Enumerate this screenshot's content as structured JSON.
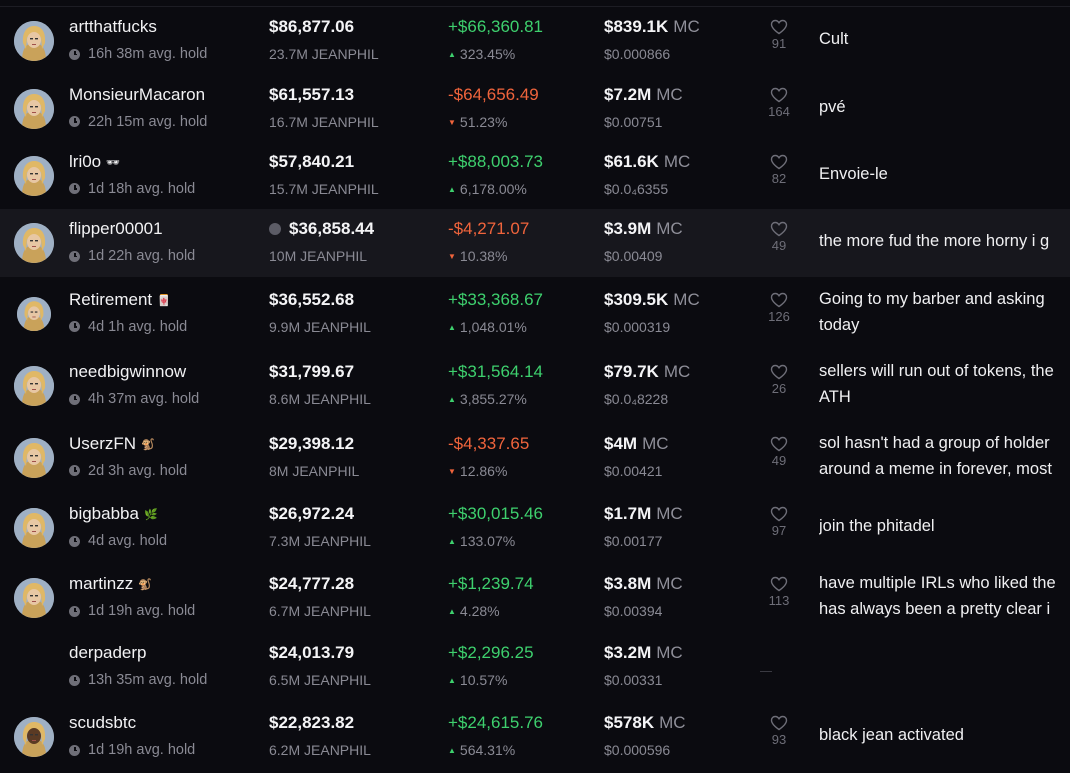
{
  "rows": [
    {
      "username": "artthatfucks",
      "badge": "",
      "hold": "16h 38m avg. hold",
      "usd": "$86,877.06",
      "tokens": "23.7M JEANPHIL",
      "pnl": "+$66,360.81",
      "pnl_dir": "up",
      "pct": "323.45%",
      "mc": "$839.1K",
      "mc_label": "MC",
      "price": "$0.000866",
      "likes": "91",
      "comment": "Cult"
    },
    {
      "username": "MonsieurMacaron",
      "badge": "",
      "hold": "22h 15m avg. hold",
      "usd": "$61,557.13",
      "tokens": "16.7M JEANPHIL",
      "pnl": "-$64,656.49",
      "pnl_dir": "down",
      "pct": "51.23%",
      "mc": "$7.2M",
      "mc_label": "MC",
      "price": "$0.00751",
      "likes": "164",
      "comment": "pvé"
    },
    {
      "username": "lri0o",
      "badge": "🕶",
      "hold": "1d 18h avg. hold",
      "usd": "$57,840.21",
      "tokens": "15.7M JEANPHIL",
      "pnl": "+$88,003.73",
      "pnl_dir": "up",
      "pct": "6,178.00%",
      "mc": "$61.6K",
      "mc_label": "MC",
      "price": "$0.0₄6355",
      "likes": "82",
      "comment": "Envoie-le"
    },
    {
      "username": "flipper00001",
      "badge": "",
      "hold": "1d 22h avg. hold",
      "usd": "$36,858.44",
      "usd_icon": "info-icon",
      "tokens": "10M JEANPHIL",
      "pnl": "-$4,271.07",
      "pnl_dir": "down",
      "pct": "10.38%",
      "mc": "$3.9M",
      "mc_label": "MC",
      "price": "$0.00409",
      "likes": "49",
      "comment": "the more fud the more horny i g"
    },
    {
      "username": "Retirement",
      "badge": "🀄",
      "hold": "4d 1h avg. hold",
      "usd": "$36,552.68",
      "tokens": "9.9M JEANPHIL",
      "pnl": "+$33,368.67",
      "pnl_dir": "up",
      "pct": "1,048.01%",
      "mc": "$309.5K",
      "mc_label": "MC",
      "price": "$0.000319",
      "likes": "126",
      "comment": "Going to my barber and asking \ntoday"
    },
    {
      "username": "needbigwinnow",
      "badge": "",
      "hold": "4h 37m avg. hold",
      "usd": "$31,799.67",
      "tokens": "8.6M JEANPHIL",
      "pnl": "+$31,564.14",
      "pnl_dir": "up",
      "pct": "3,855.27%",
      "mc": "$79.7K",
      "mc_label": "MC",
      "price": "$0.0₄8228",
      "likes": "26",
      "comment": "sellers will run out of tokens, the\nATH"
    },
    {
      "username": "UserzFN",
      "badge": "🐒",
      "hold": "2d 3h avg. hold",
      "usd": "$29,398.12",
      "tokens": "8M JEANPHIL",
      "pnl": "-$4,337.65",
      "pnl_dir": "down",
      "pct": "12.86%",
      "mc": "$4M",
      "mc_label": "MC",
      "price": "$0.00421",
      "likes": "49",
      "comment": "sol hasn't had a group of holder\naround a meme in forever, most"
    },
    {
      "username": "bigbabba",
      "badge": "🌿",
      "hold": "4d avg. hold",
      "usd": "$26,972.24",
      "tokens": "7.3M JEANPHIL",
      "pnl": "+$30,015.46",
      "pnl_dir": "up",
      "pct": "133.07%",
      "mc": "$1.7M",
      "mc_label": "MC",
      "price": "$0.00177",
      "likes": "97",
      "comment": "join the phitadel"
    },
    {
      "username": "martinzz",
      "badge": "🐒",
      "hold": "1d 19h avg. hold",
      "usd": "$24,777.28",
      "tokens": "6.7M JEANPHIL",
      "pnl": "+$1,239.74",
      "pnl_dir": "up",
      "pct": "4.28%",
      "mc": "$3.8M",
      "mc_label": "MC",
      "price": "$0.00394",
      "likes": "113",
      "comment": "have multiple IRLs who liked the\nhas always been a pretty clear i"
    },
    {
      "username": "derpaderp",
      "badge": "",
      "hold": "13h 35m avg. hold",
      "usd": "$24,013.79",
      "tokens": "6.5M JEANPHIL",
      "pnl": "+$2,296.25",
      "pnl_dir": "up",
      "pct": "10.57%",
      "mc": "$3.2M",
      "mc_label": "MC",
      "price": "$0.00331",
      "likes": "",
      "comment": ""
    },
    {
      "username": "scudsbtc",
      "badge": "",
      "hold": "1d 19h avg. hold",
      "usd": "$22,823.82",
      "tokens": "6.2M JEANPHIL",
      "pnl": "+$24,615.76",
      "pnl_dir": "up",
      "pct": "564.31%",
      "mc": "$578K",
      "mc_label": "MC",
      "price": "$0.000596",
      "likes": "93",
      "comment": "black jean activated"
    }
  ],
  "colors": {
    "up": "#3ed06e",
    "down": "#f0643c",
    "background": "#0b0b10"
  },
  "icons": {
    "clock": "clock-icon",
    "heart": "heart-icon",
    "avatar": "avatar",
    "info": "info-icon"
  }
}
